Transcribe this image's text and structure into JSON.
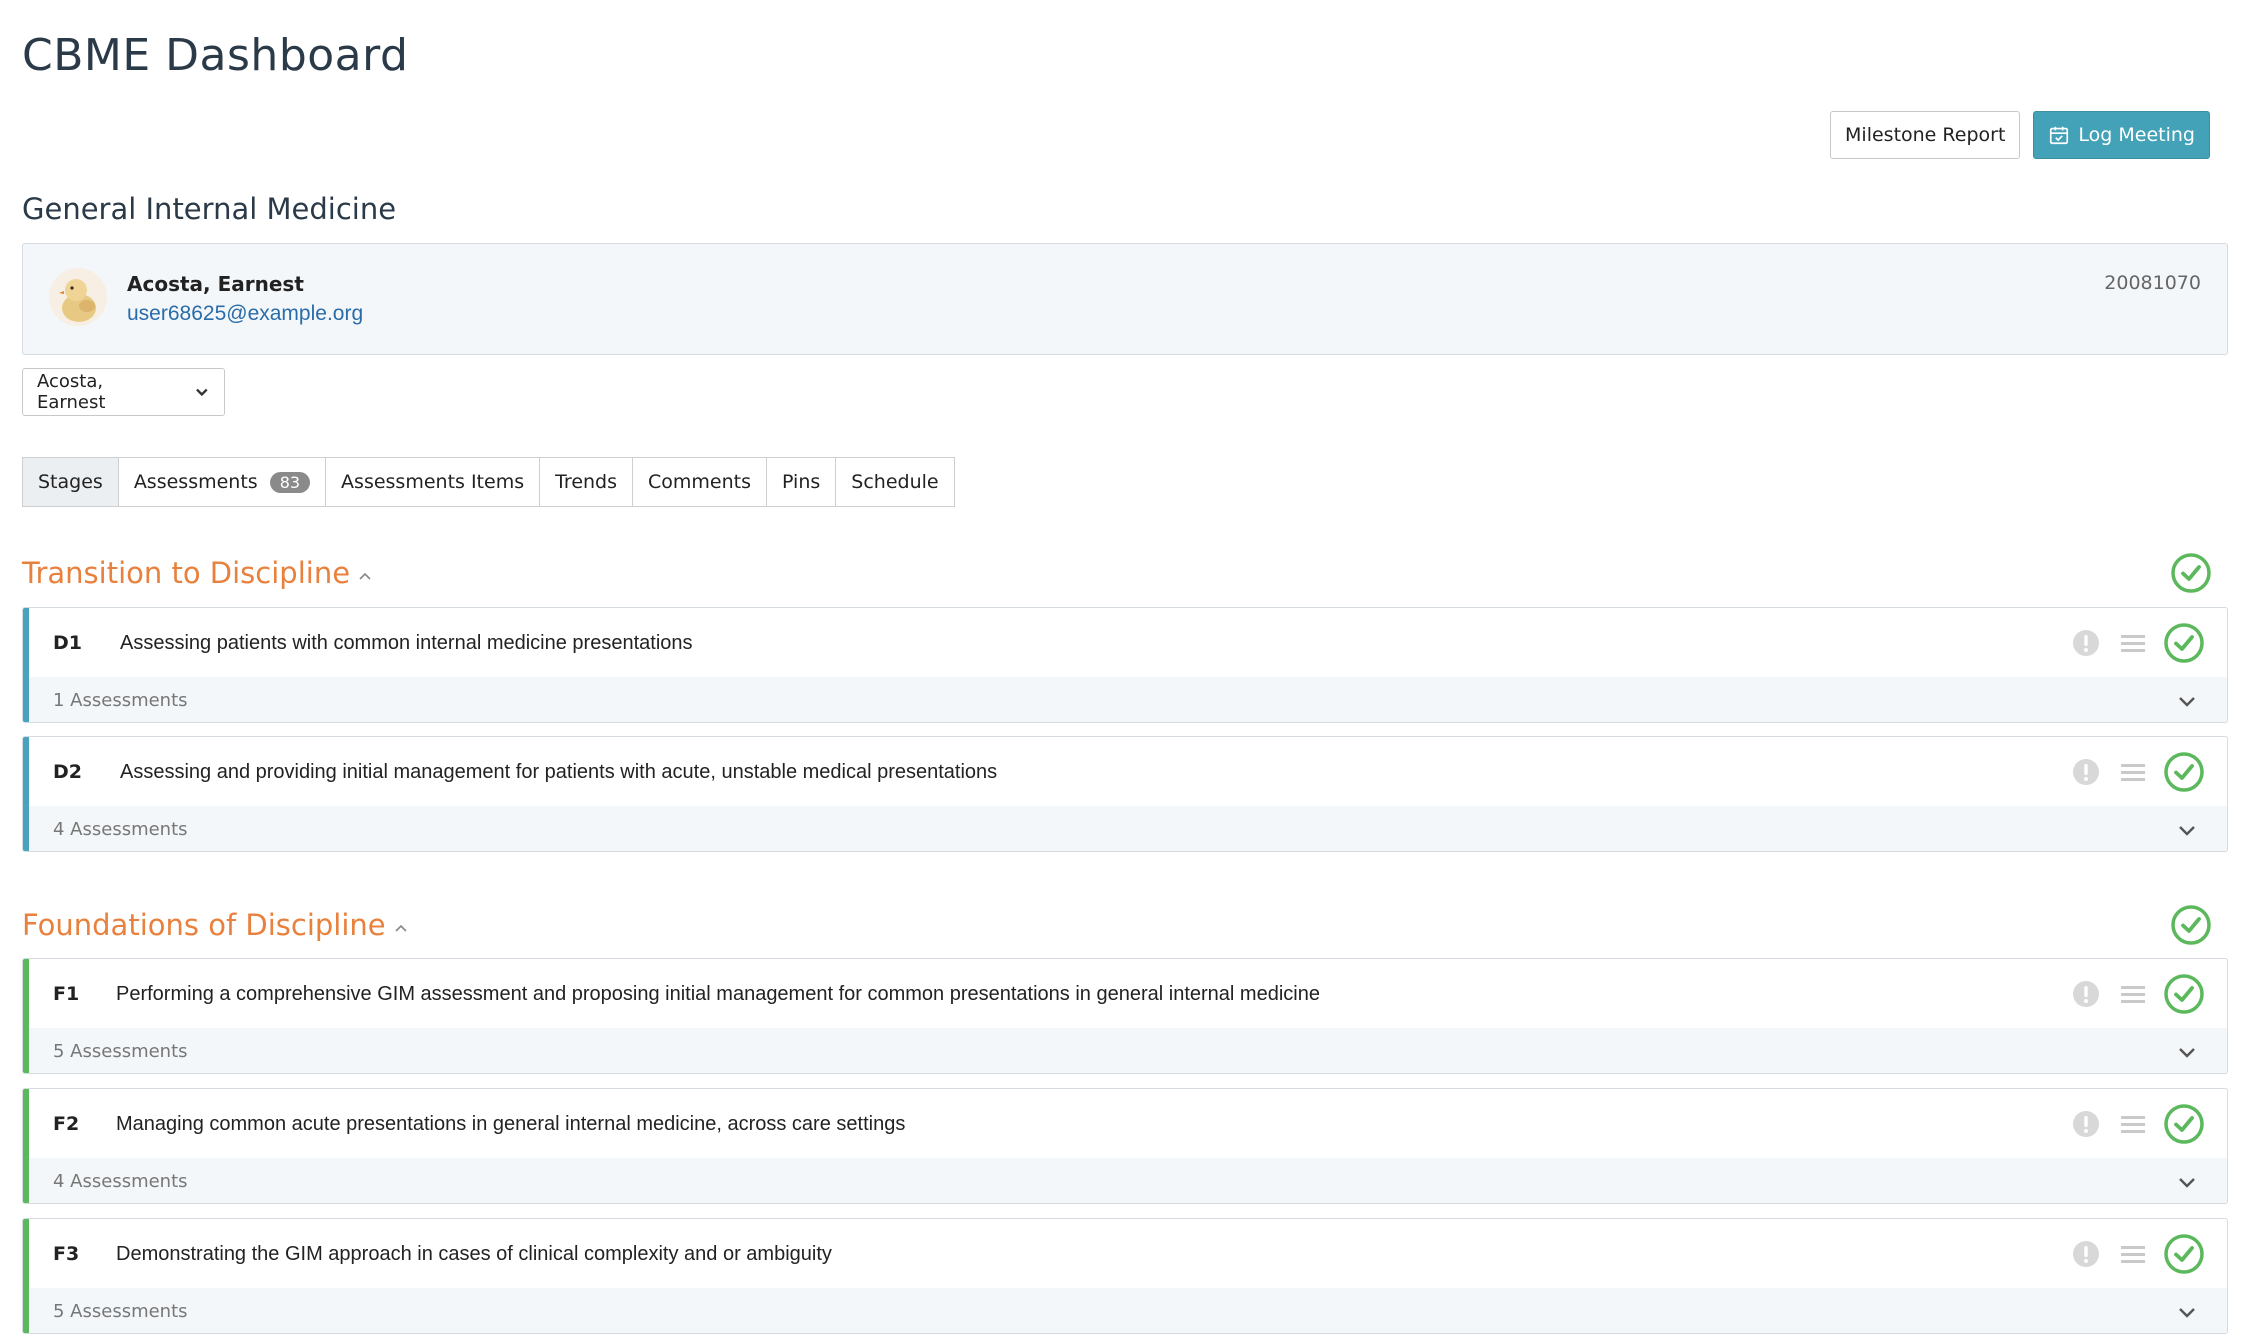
{
  "header": {
    "title": "CBME Dashboard"
  },
  "actions": {
    "milestone_report": "Milestone Report",
    "log_meeting": "Log Meeting"
  },
  "course": {
    "name": "General Internal Medicine"
  },
  "learner": {
    "name": "Acosta, Earnest",
    "email": "user68625@example.org",
    "id": "20081070"
  },
  "learner_select": {
    "value": "Acosta, Earnest"
  },
  "tabs": [
    {
      "label": "Stages"
    },
    {
      "label": "Assessments",
      "badge": "83"
    },
    {
      "label": "Assessments Items"
    },
    {
      "label": "Trends"
    },
    {
      "label": "Comments"
    },
    {
      "label": "Pins"
    },
    {
      "label": "Schedule"
    }
  ],
  "colors": {
    "accent": "#43a2b8",
    "stage_title": "#e8813d",
    "transition_bar": "#4aa3bc",
    "foundations_bar": "#5cb85c",
    "complete": "#5cb85c"
  },
  "stages": [
    {
      "title": "Transition to Discipline",
      "epas": [
        {
          "code": "D1",
          "description": "Assessing patients with common internal medicine presentations",
          "assessments": "1 Assessments"
        },
        {
          "code": "D2",
          "description": "Assessing and providing initial management for patients with acute, unstable medical presentations",
          "assessments": "4 Assessments"
        }
      ]
    },
    {
      "title": "Foundations of Discipline",
      "epas": [
        {
          "code": "F1",
          "description": "Performing a comprehensive GIM assessment and proposing initial management for common presentations in general internal medicine",
          "assessments": "5 Assessments"
        },
        {
          "code": "F2",
          "description": "Managing common acute presentations in general internal medicine, across care settings",
          "assessments": "4 Assessments"
        },
        {
          "code": "F3",
          "description": "Demonstrating the GIM approach in cases of clinical complexity and or ambiguity",
          "assessments": "5 Assessments"
        }
      ]
    }
  ]
}
